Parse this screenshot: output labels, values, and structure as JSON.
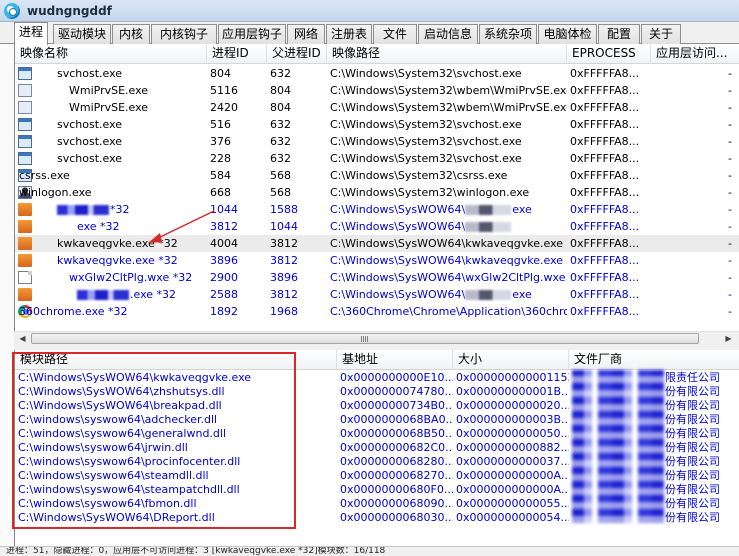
{
  "window": {
    "title": "wudngngddf"
  },
  "tabs": [
    {
      "label": "进程",
      "active": true
    },
    {
      "label": "驱动模块"
    },
    {
      "label": "内核"
    },
    {
      "label": "内核钩子"
    },
    {
      "label": "应用层钩子"
    },
    {
      "label": "网络"
    },
    {
      "label": "注册表"
    },
    {
      "label": "文件"
    },
    {
      "label": "启动信息"
    },
    {
      "label": "系统杂项"
    },
    {
      "label": "电脑体检"
    },
    {
      "label": "配置"
    },
    {
      "label": "关于"
    }
  ],
  "process_table": {
    "columns": [
      "映像名称",
      "进程ID",
      "父进程ID",
      "映像路径",
      "EPROCESS",
      "应用层访问..."
    ],
    "rows": [
      {
        "name": "svchost.exe",
        "pid": "804",
        "ppid": "632",
        "path": "C:\\Windows\\System32\\svchost.exe",
        "eprocess": "0xFFFFFA8...",
        "access": "-",
        "color": "black",
        "icon": "window-icon"
      },
      {
        "name": "WmiPrvSE.exe",
        "pid": "5116",
        "ppid": "804",
        "path": "C:\\Windows\\System32\\wbem\\WmiPrvSE.exe",
        "eprocess": "0xFFFFFA8...",
        "access": "-",
        "color": "black",
        "icon": "app-icon"
      },
      {
        "name": "WmiPrvSE.exe",
        "pid": "2420",
        "ppid": "804",
        "path": "C:\\Windows\\System32\\wbem\\WmiPrvSE.exe",
        "eprocess": "0xFFFFFA8...",
        "access": "-",
        "color": "black",
        "icon": "app-icon"
      },
      {
        "name": "svchost.exe",
        "pid": "516",
        "ppid": "632",
        "path": "C:\\Windows\\System32\\svchost.exe",
        "eprocess": "0xFFFFFA8...",
        "access": "-",
        "color": "black",
        "icon": "window-icon"
      },
      {
        "name": "svchost.exe",
        "pid": "376",
        "ppid": "632",
        "path": "C:\\Windows\\System32\\svchost.exe",
        "eprocess": "0xFFFFFA8...",
        "access": "-",
        "color": "black",
        "icon": "window-icon"
      },
      {
        "name": "svchost.exe",
        "pid": "228",
        "ppid": "632",
        "path": "C:\\Windows\\System32\\svchost.exe",
        "eprocess": "0xFFFFFA8...",
        "access": "-",
        "color": "black",
        "icon": "window-icon"
      },
      {
        "name": "csrss.exe",
        "pid": "584",
        "ppid": "568",
        "path": "C:\\Windows\\System32\\csrss.exe",
        "eprocess": "0xFFFFFA8...",
        "access": "-",
        "color": "black",
        "icon": "window-icon"
      },
      {
        "name": "winlogon.exe",
        "pid": "668",
        "ppid": "568",
        "path": "C:\\Windows\\System32\\winlogon.exe",
        "eprocess": "0xFFFFFA8...",
        "access": "-",
        "color": "black",
        "icon": "user-icon"
      },
      {
        "name": "*32",
        "pid": "1044",
        "ppid": "1588",
        "path": "C:\\Windows\\SysWOW64\\",
        "path_suffix": "exe",
        "eprocess": "0xFFFFFA8...",
        "access": "-",
        "color": "blue",
        "icon": "redacted-icon",
        "redacted_name": true
      },
      {
        "name": "exe *32",
        "pid": "3812",
        "ppid": "1044",
        "path": "C:\\Windows\\SysWOW64\\",
        "path_suffix": "",
        "eprocess": "0xFFFFFA8...",
        "access": "-",
        "color": "blue",
        "icon": "orange-icon",
        "redacted_name": true
      },
      {
        "name": "kwkaveqgvke.exe *32",
        "pid": "4004",
        "ppid": "3812",
        "path": "C:\\Windows\\SysWOW64\\kwkaveqgvke.exe",
        "eprocess": "0xFFFFFA8...",
        "access": "-",
        "color": "black",
        "icon": "orange-icon",
        "selected": true
      },
      {
        "name": "kwkaveqgvke.exe *32",
        "pid": "3896",
        "ppid": "3812",
        "path": "C:\\Windows\\SysWOW64\\kwkaveqgvke.exe",
        "eprocess": "0xFFFFFA8...",
        "access": "-",
        "color": "blue",
        "icon": "orange-icon"
      },
      {
        "name": "wxGlw2CltPlg.wxe *32",
        "pid": "2900",
        "ppid": "3896",
        "path": "C:\\Windows\\SysWOW64\\wxGlw2CltPlg.wxe",
        "eprocess": "0xFFFFFA8...",
        "access": "-",
        "color": "blue",
        "icon": "document-icon"
      },
      {
        "name": ".exe *32",
        "pid": "2588",
        "ppid": "3812",
        "path": "C:\\Windows\\SysWOW64\\",
        "path_suffix": "exe",
        "eprocess": "0xFFFFFA8...",
        "access": "-",
        "color": "blue",
        "icon": "redacted-icon",
        "redacted_name": true
      },
      {
        "name": "360chrome.exe *32",
        "pid": "1892",
        "ppid": "1968",
        "path": "C:\\360Chrome\\Chrome\\Application\\360chro...",
        "eprocess": "0xFFFFFA8...",
        "access": "-",
        "color": "blue",
        "icon": "chrome-icon"
      }
    ]
  },
  "module_table": {
    "columns": [
      "模块路径",
      "基地址",
      "大小",
      "文件厂商"
    ],
    "rows": [
      {
        "path": "C:\\Windows\\SysWOW64\\kwkaveqgvke.exe",
        "base": "0x0000000000E10...",
        "size": "0x000000000001153...",
        "vendor": "限责任公司"
      },
      {
        "path": "C:\\Windows\\SysWOW64\\zhshutsys.dll",
        "base": "0x0000000074780...",
        "size": "0x000000000001B...",
        "vendor": "份有限公司"
      },
      {
        "path": "C:\\Windows\\SysWOW64\\breakpad.dll",
        "base": "0x00000000734B0...",
        "size": "0x0000000000020...",
        "vendor": "份有限公司"
      },
      {
        "path": "C:\\windows\\syswow64\\adchecker.dll",
        "base": "0x0000000068BA0...",
        "size": "0x000000000003B...",
        "vendor": "份有限公司"
      },
      {
        "path": "C:\\windows\\syswow64\\generalwnd.dll",
        "base": "0x0000000068B50...",
        "size": "0x0000000000050...",
        "vendor": "份有限公司"
      },
      {
        "path": "C:\\windows\\syswow64\\jrwin.dll",
        "base": "0x00000000682C0...",
        "size": "0x0000000000882...",
        "vendor": "份有限公司"
      },
      {
        "path": "C:\\windows\\syswow64\\procinfocenter.dll",
        "base": "0x0000000068280...",
        "size": "0x0000000000037...",
        "vendor": "份有限公司"
      },
      {
        "path": "C:\\windows\\syswow64\\steamdll.dll",
        "base": "0x0000000068270...",
        "size": "0x000000000000A...",
        "vendor": "份有限公司"
      },
      {
        "path": "C:\\windows\\syswow64\\steampatchdll.dll",
        "base": "0x00000000680F0...",
        "size": "0x000000000000A...",
        "vendor": "份有限公司"
      },
      {
        "path": "C:\\windows\\syswow64\\fbmon.dll",
        "base": "0x0000000068090...",
        "size": "0x0000000000055...",
        "vendor": "份有限公司"
      },
      {
        "path": "C:\\Windows\\SysWOW64\\DReport.dll",
        "base": "0x0000000068030...",
        "size": "0x0000000000054...",
        "vendor": "份有限公司"
      }
    ]
  },
  "status": {
    "text": "进程：51，隐藏进程：0，应用层不可访问进程：3    [kwkaveqgvke.exe *32]模块数：16/118"
  },
  "colors": {
    "blue_text": "#0000d0",
    "annotation_red": "#d62828",
    "selected_row": "#ebebeb"
  }
}
